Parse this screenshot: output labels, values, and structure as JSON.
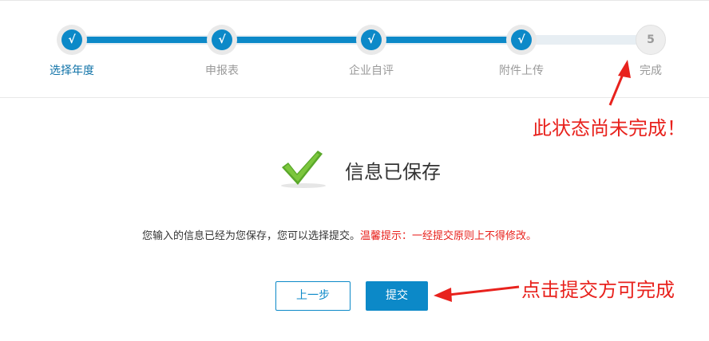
{
  "stepper": {
    "steps": [
      {
        "label": "选择年度",
        "marker": "√",
        "status": "done",
        "current": true
      },
      {
        "label": "申报表",
        "marker": "√",
        "status": "done"
      },
      {
        "label": "企业自评",
        "marker": "√",
        "status": "done"
      },
      {
        "label": "附件上传",
        "marker": "√",
        "status": "done"
      },
      {
        "label": "完成",
        "marker": "5",
        "status": "pending"
      }
    ]
  },
  "result": {
    "icon": "check-mark-icon",
    "title": "信息已保存",
    "message": "您输入的信息已经为您保存，您可以选择提交。",
    "warning": "温馨提示：一经提交原则上不得修改。"
  },
  "buttons": {
    "prev_label": "上一步",
    "submit_label": "提交"
  },
  "annotations": {
    "step_note": "此状态尚未完成！",
    "submit_note": "点击提交方可完成"
  },
  "colors": {
    "accent": "#0c89c8",
    "annotation": "#e8221d",
    "check": "#5aa82a"
  }
}
